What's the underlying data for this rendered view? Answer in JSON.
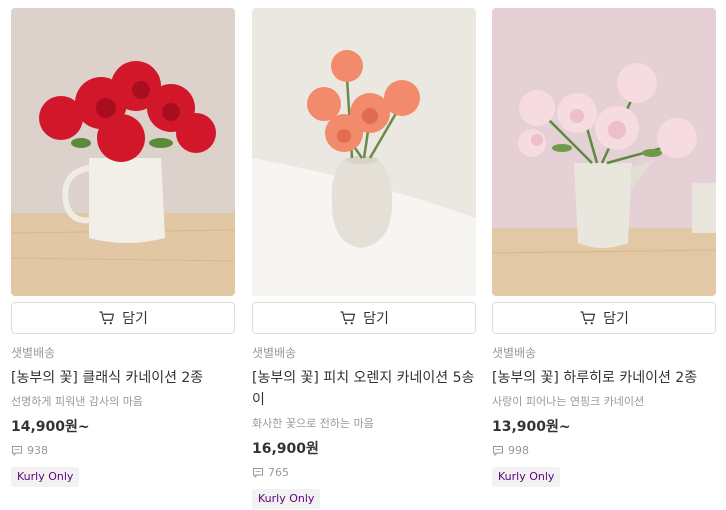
{
  "products": [
    {
      "cart_label": "담기",
      "delivery": "샛별배송",
      "name": "[농부의 꽃] 클래식 카네이션 2종",
      "description": "선명하게 피워낸 감사의 마음",
      "price": "14,900원~",
      "review_count": "938",
      "badge": "Kurly Only",
      "image_icon": "red-carnation-vase",
      "flower_color": "#d3172b",
      "bg_color": "#d9cfc9"
    },
    {
      "cart_label": "담기",
      "delivery": "샛별배송",
      "name": "[농부의 꽃] 피치 오렌지 카네이션 5송이",
      "description": "화사한 꽃으로 전하는 마음",
      "price": "16,900원",
      "review_count": "765",
      "badge": "Kurly Only",
      "image_icon": "peach-carnation-vase",
      "flower_color": "#f28a6c",
      "bg_color": "#e8e5dd"
    },
    {
      "cart_label": "담기",
      "delivery": "샛별배송",
      "name": "[농부의 꽃] 하루히로 카네이션 2종",
      "description": "사랑이 피어나는 연핑크 카네이션",
      "price": "13,900원~",
      "review_count": "998",
      "badge": "Kurly Only",
      "image_icon": "pink-carnation-vase",
      "flower_color": "#f6dbe0",
      "bg_color": "#e6d3d7"
    }
  ]
}
